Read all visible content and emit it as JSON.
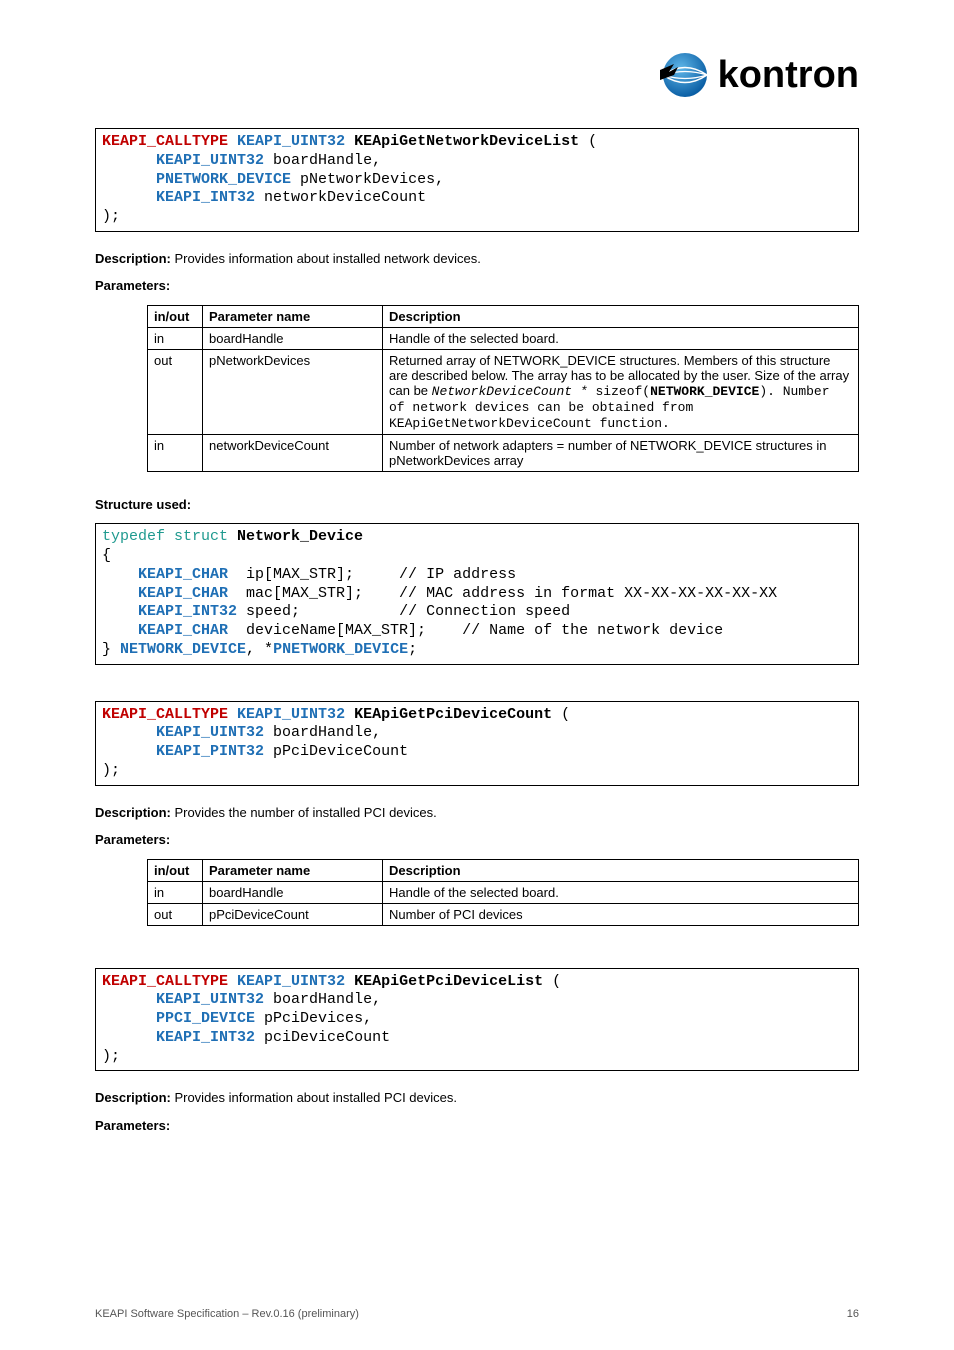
{
  "logo": {
    "brand": "kontron"
  },
  "code1": {
    "sig_pref": "KEAPI_CALLTYPE",
    "sig_ret": "KEAPI_UINT32",
    "sig_name": "KEApiGetNetworkDeviceList",
    "p1_type": "KEAPI_UINT32",
    "p1_name": " boardHandle,",
    "p2_type": "PNETWORK_DEVICE",
    "p2_name": " pNetworkDevices,",
    "p3_type": "KEAPI_INT32",
    "p3_name": " networkDeviceCount",
    "close": ");"
  },
  "desc1": {
    "label": "Description:",
    "text": " Provides information about installed network devices.",
    "paramlabel": "Parameters:"
  },
  "table1": {
    "h1": "in/out",
    "h2": "Parameter name",
    "h3": "Description",
    "r1c1": "in",
    "r1c2": "boardHandle",
    "r1c3": "Handle of the selected board.",
    "r2c1": "out",
    "r2c2": "pNetworkDevices",
    "r2c3a": "Returned array of NETWORK_DEVICE structures. Members of this structure are described below. The array has to be allocated by the user. Size of the array can be ",
    "r2c3b": "NetworkDeviceCount * ",
    "r2c3c": "sizeof(",
    "r2c3d": "NETWORK_DEVICE",
    "r2c3e": "). Number of network devices can be obtained from KEApiGetNetworkDeviceCount function.",
    "r3c1": "in",
    "r3c2": "networkDeviceCount",
    "r3c3": "Number of network adapters = number of NETWORK_DEVICE structures in pNetworkDevices array"
  },
  "struct1_label": "Structure used:",
  "struct1": {
    "l1a": "typedef struct",
    "l1b": " Network_Device",
    "l2": "{",
    "l3a": "KEAPI_CHAR",
    "l3b": "  ip[MAX_STR];     // IP address",
    "l4a": "KEAPI_CHAR",
    "l4b": "  mac[MAX_STR];    // MAC address in format XX-XX-XX-XX-XX-XX",
    "l5a": "KEAPI_INT32",
    "l5b": " speed;           // Connection speed",
    "l6a": "KEAPI_CHAR",
    "l6b": "  deviceName[MAX_STR];    // Name of the network device",
    "l7a": "} ",
    "l7b": "NETWORK_DEVICE",
    "l7c": ", *",
    "l7d": "PNETWORK_DEVICE",
    "l7e": ";"
  },
  "code2": {
    "sig_pref": "KEAPI_CALLTYPE",
    "sig_ret": "KEAPI_UINT32",
    "sig_name": "KEApiGetPciDeviceCount",
    "p1_type": "KEAPI_UINT32",
    "p1_name": " boardHandle,",
    "p2_type": "KEAPI_PINT32",
    "p2_name": " pPciDeviceCount",
    "close": ");"
  },
  "desc2": {
    "label": "Description:",
    "text": " Provides the number of installed PCI devices.",
    "paramlabel": "Parameters:"
  },
  "table2": {
    "h1": "in/out",
    "h2": "Parameter name",
    "h3": "Description",
    "r1c1": "in",
    "r1c2": "boardHandle",
    "r1c3": "Handle of the selected board.",
    "r2c1": "out",
    "r2c2": "pPciDeviceCount",
    "r2c3": "Number of PCI devices"
  },
  "code3": {
    "sig_pref": "KEAPI_CALLTYPE",
    "sig_ret": "KEAPI_UINT32",
    "sig_name": "KEApiGetPciDeviceList",
    "p1_type": "KEAPI_UINT32",
    "p1_name": " boardHandle,",
    "p2_type": "PPCI_DEVICE",
    "p2_name": " pPciDevices,",
    "p3_type": "KEAPI_INT32",
    "p3_name": " pciDeviceCount",
    "close": ");"
  },
  "desc3": {
    "label": "Description:",
    "text": " Provides information about installed PCI devices.",
    "paramlabel": "Parameters:"
  },
  "footer": {
    "left": "KEAPI Software Specification – Rev.0.16 (preliminary)",
    "right": "16"
  }
}
